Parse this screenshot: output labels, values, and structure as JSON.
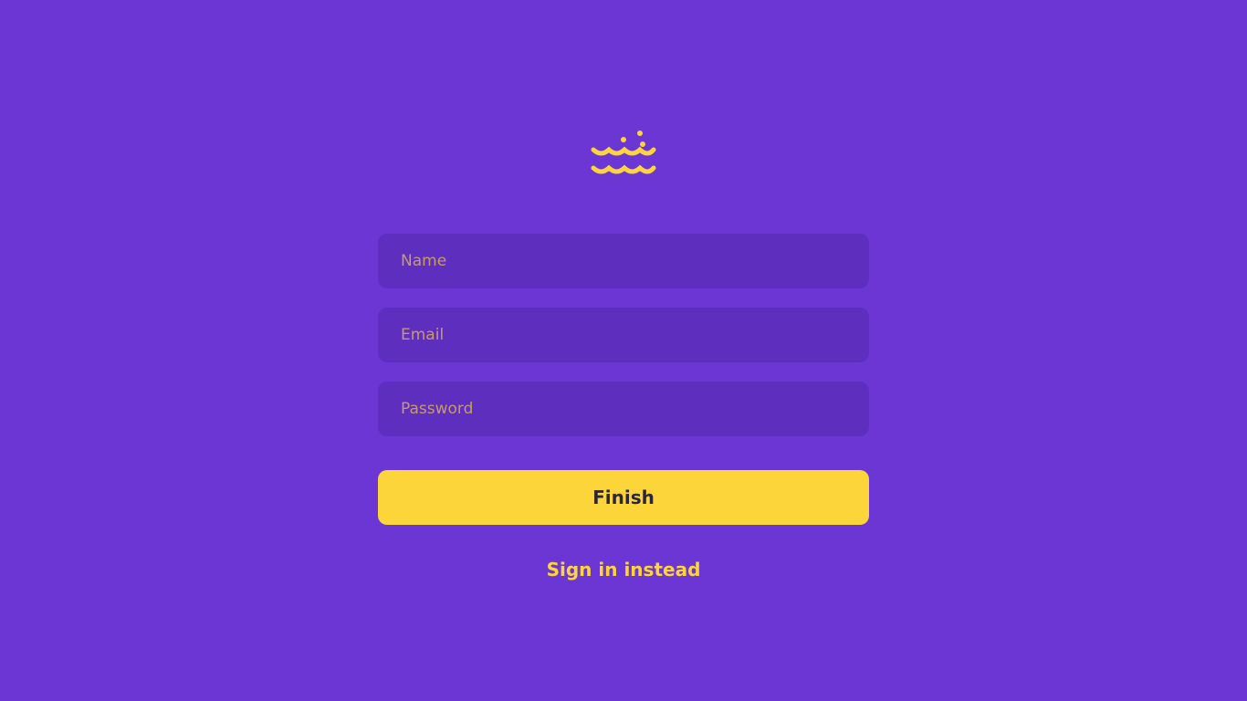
{
  "logo": {
    "icon": "waves-bubbles-icon",
    "color": "#fcd53b"
  },
  "form": {
    "name_placeholder": "Name",
    "email_placeholder": "Email",
    "password_placeholder": "Password"
  },
  "actions": {
    "finish_label": "Finish",
    "signin_label": "Sign in instead"
  },
  "colors": {
    "background": "#6c36d4",
    "field_background": "#5e2fbf",
    "accent": "#fcd53b"
  }
}
